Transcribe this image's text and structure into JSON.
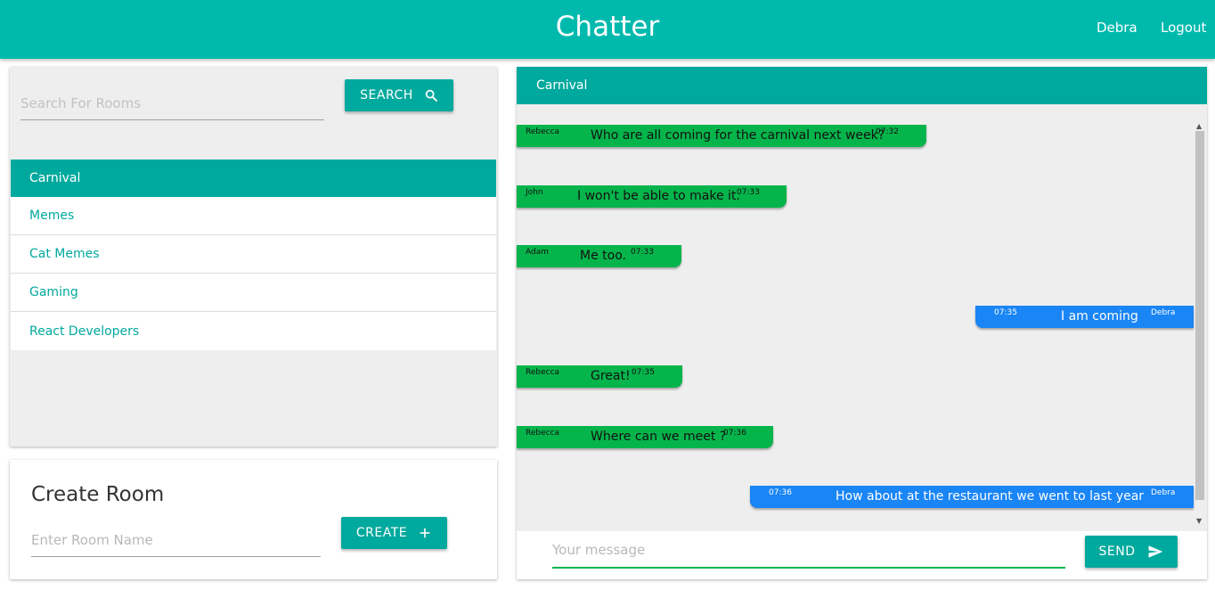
{
  "header": {
    "title": "Chatter",
    "user": "Debra",
    "logout": "Logout"
  },
  "search": {
    "placeholder": "Search For Rooms",
    "button_label": "SEARCH"
  },
  "rooms": [
    "Carnival",
    "Memes",
    "Cat Memes",
    "Gaming",
    "React Developers"
  ],
  "active_room": "Carnival",
  "create_room": {
    "title": "Create Room",
    "placeholder": "Enter Room Name",
    "button_label": "CREATE"
  },
  "chat": {
    "room_title": "Carnival",
    "messages": [
      {
        "sender": "Rebecca",
        "text": "Who are all coming for the carnival next week?",
        "time": "07:32",
        "mine": false
      },
      {
        "sender": "John",
        "text": "I won't be able to make it.",
        "time": "07:33",
        "mine": false
      },
      {
        "sender": "Adam",
        "text": "Me too.",
        "time": "07:33",
        "mine": false
      },
      {
        "sender": "Debra",
        "text": "I am coming",
        "time": "07:35",
        "mine": true
      },
      {
        "sender": "Rebecca",
        "text": "Great!",
        "time": "07:35",
        "mine": false
      },
      {
        "sender": "Rebecca",
        "text": "Where can we meet ?",
        "time": "07:36",
        "mine": false
      },
      {
        "sender": "Debra",
        "text": "How about at the restaurant we went to last year",
        "time": "07:36",
        "mine": true
      }
    ],
    "message_placeholder": "Your message",
    "send_label": "SEND"
  },
  "colors": {
    "primary": "#00b9ad",
    "accent": "#00a99d",
    "incoming_bubble": "#05b54b",
    "outgoing_bubble": "#1a85f5"
  },
  "icons": {
    "search_button": "search-icon",
    "create_button": "plus-icon",
    "send_button": "send-icon"
  }
}
